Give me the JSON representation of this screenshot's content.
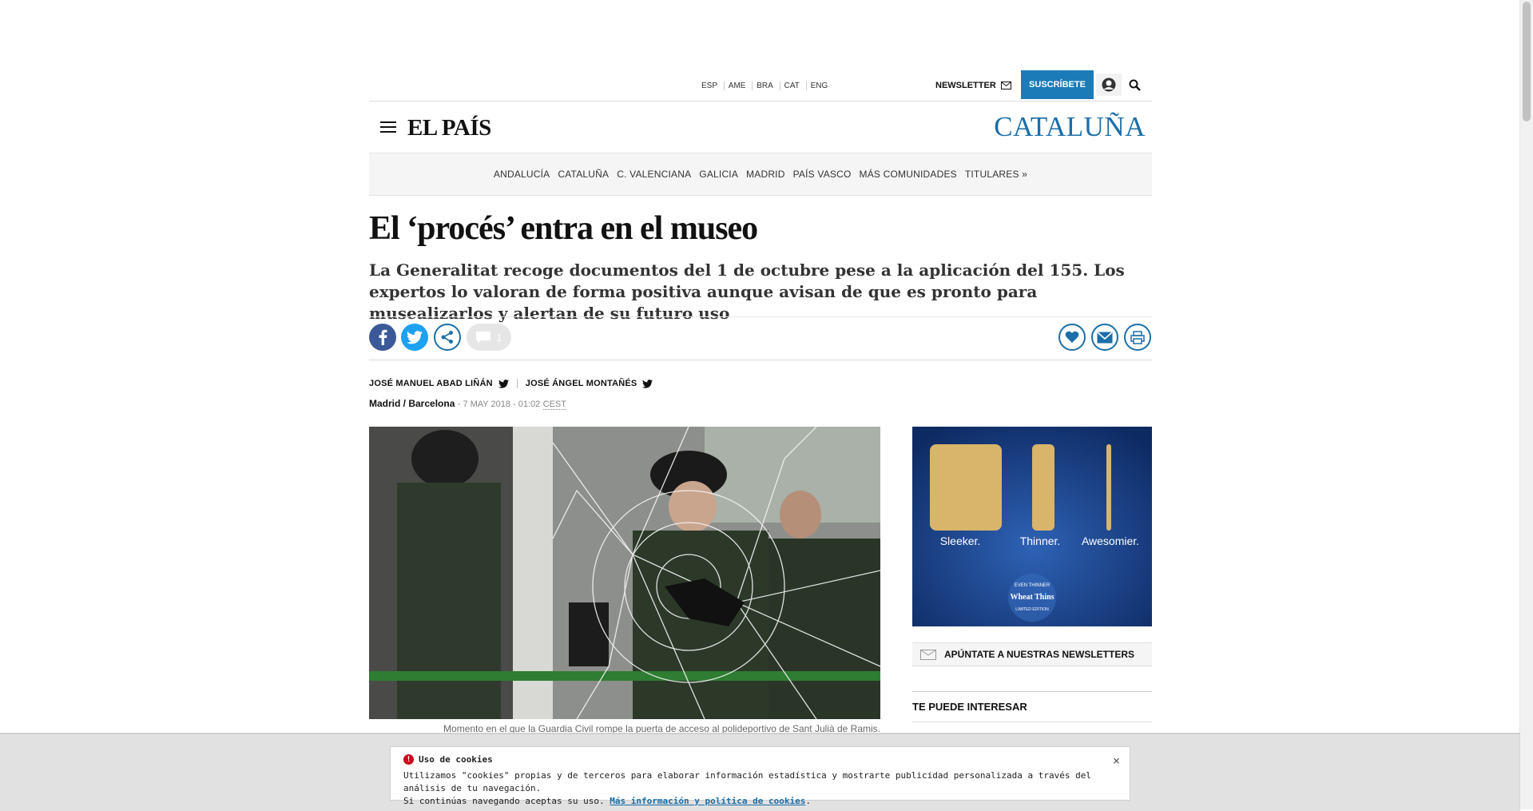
{
  "editions": [
    "ESP",
    "AME",
    "BRA",
    "CAT",
    "ENG"
  ],
  "header": {
    "newsletter_label": "NEWSLETTER",
    "subscribe_label": "SUSCRÍBETE",
    "logo": "EL PAÍS",
    "section": "CATALUÑA"
  },
  "nav": {
    "items": [
      "ANDALUCÍA",
      "CATALUÑA",
      "C. VALENCIANA",
      "GALICIA",
      "MADRID",
      "PAÍS VASCO",
      "MÁS COMUNIDADES",
      "TITULARES »"
    ]
  },
  "article": {
    "title": "El ‘procés’ entra en el museo",
    "subtitle": "La Generalitat recoge documentos del 1 de octubre pese a la aplicación del 155. Los expertos lo valoran de forma positiva aunque avisan de que es pronto para musealizarlos y alertan de su futuro uso",
    "comment_count": "1",
    "author1": "JOSÉ MANUEL ABAD LIÑÁN",
    "author2": "JOSÉ ÁNGEL MONTAÑÉS",
    "place": "Madrid / Barcelona",
    "date": "- 7 MAY 2018 - 01:02",
    "timezone": "CEST",
    "caption": "Momento en el que la Guardia Civil rompe la puerta de acceso al polideportivo de Sant Julià de Ramis."
  },
  "aside": {
    "ad_labels": [
      "Sleeker.",
      "Thinner.",
      "Awesomier."
    ],
    "ad_brand_top": "EVEN THINNER",
    "ad_brand": "Wheat Thins",
    "ad_brand_bottom": "LIMITED EDITION",
    "newsletter_cta": "APÚNTATE A NUESTRAS NEWSLETTERS",
    "interest_title": "TE PUEDE INTERESAR"
  },
  "cookies": {
    "title": "Uso de cookies",
    "line1": "Utilizamos \"cookies\" propias y de terceros para elaborar información estadística y mostrarte publicidad personalizada a través del análisis de tu navegación.",
    "line2_prefix": "Si continúas navegando aceptas su uso.",
    "link": "Más información y política de cookies",
    "close": "×"
  },
  "colors": {
    "brand_blue": "#1b6ea8",
    "subscribe_bg": "#1b7bb8",
    "facebook": "#3b5998",
    "twitter": "#1da1f2"
  }
}
